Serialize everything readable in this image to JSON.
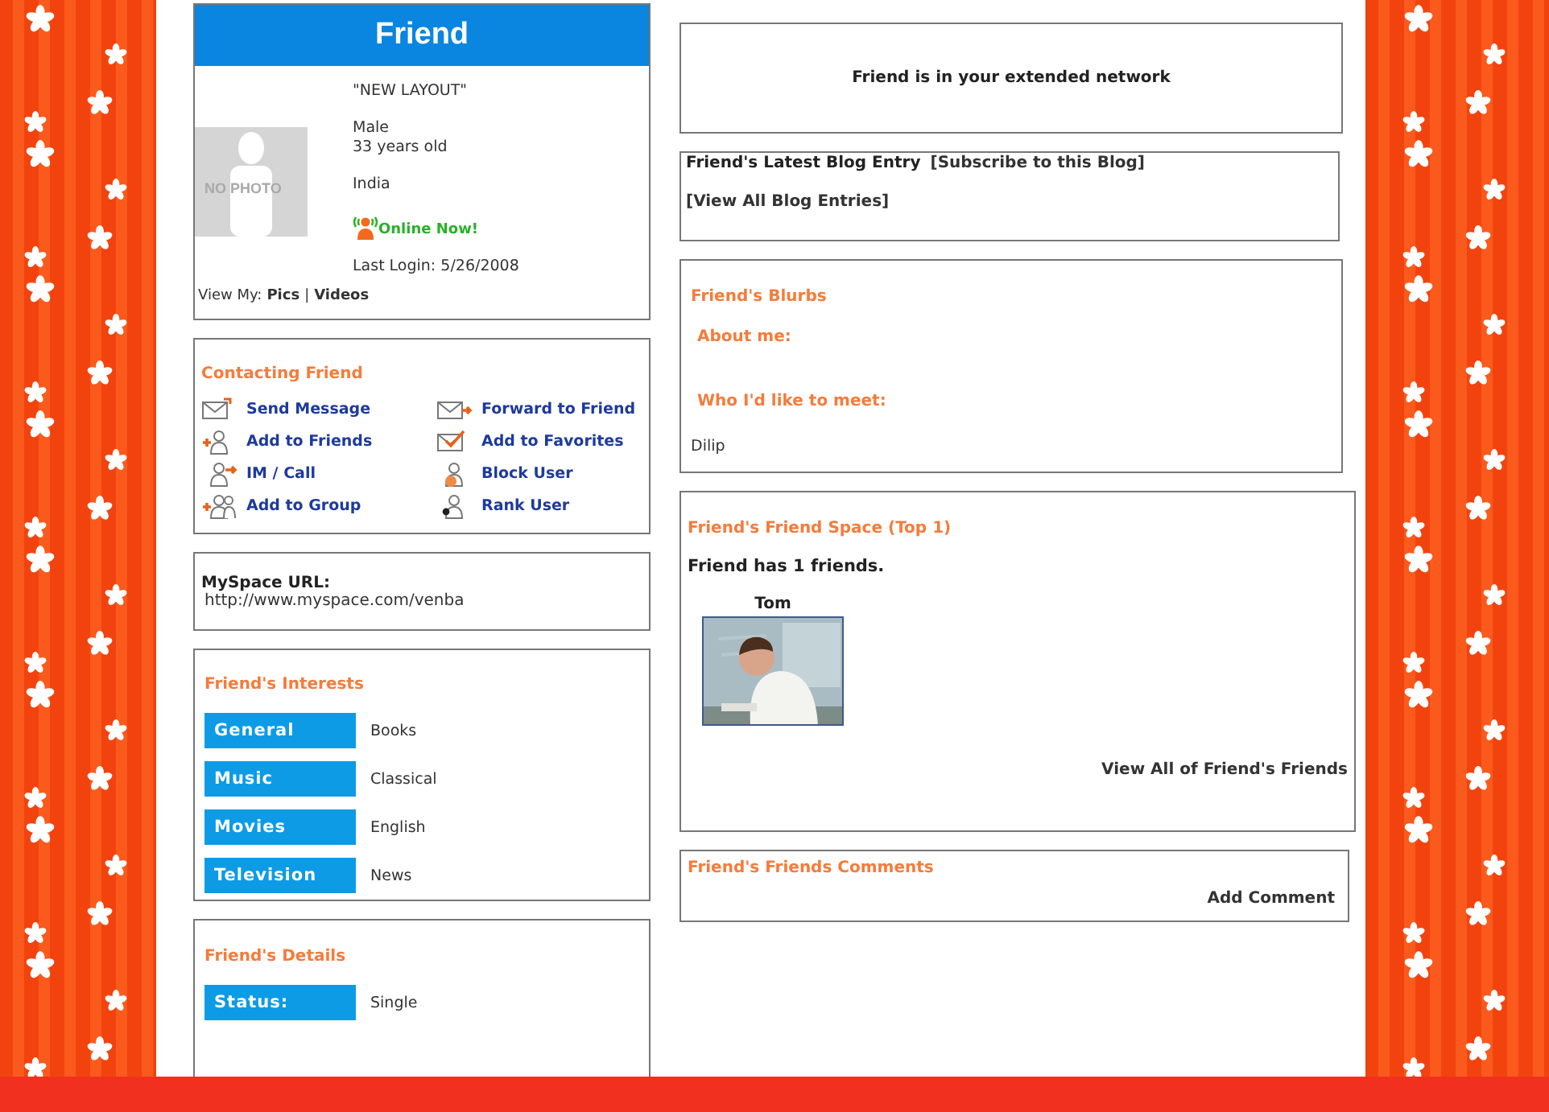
{
  "profile": {
    "title": "Friend",
    "photo_label": "NO PHOTO",
    "headline": "\"NEW LAYOUT\"",
    "gender": "Male",
    "age": "33 years old",
    "location": "India",
    "online_status": "Online Now!",
    "last_login": "Last Login: 5/26/2008",
    "view_my_label": "View My:",
    "view_links": [
      "Pics",
      "Videos"
    ],
    "view_separator": "|"
  },
  "contacting": {
    "heading": "Contacting Friend",
    "actions": [
      {
        "kind": "message",
        "label": "Send Message"
      },
      {
        "kind": "forward",
        "label": "Forward to Friend"
      },
      {
        "kind": "addfriend",
        "label": "Add to Friends"
      },
      {
        "kind": "favorite",
        "label": "Add to Favorites"
      },
      {
        "kind": "call",
        "label": "IM / Call"
      },
      {
        "kind": "block",
        "label": "Block User"
      },
      {
        "kind": "group",
        "label": "Add to Group"
      },
      {
        "kind": "rank",
        "label": "Rank User"
      }
    ]
  },
  "url_box": {
    "label": "MySpace URL:",
    "url": "http://www.myspace.com/venba"
  },
  "interests": {
    "heading": "Friend's Interests",
    "rows": [
      {
        "label": "General",
        "value": "Books"
      },
      {
        "label": "Music",
        "value": "Classical"
      },
      {
        "label": "Movies",
        "value": "English"
      },
      {
        "label": "Television",
        "value": "News"
      }
    ]
  },
  "details": {
    "heading": "Friend's Details",
    "rows": [
      {
        "label": "Status:",
        "value": "Single"
      }
    ]
  },
  "network_notice": "Friend is in your extended network",
  "blog": {
    "heading": "Friend's Latest Blog Entry",
    "subscribe_link": "[Subscribe to this Blog]",
    "view_all_link": "[View All Blog Entries]"
  },
  "blurbs": {
    "heading": "Friend's Blurbs",
    "about_label": "About me:",
    "meet_label": "Who I'd like to meet:",
    "meet_text": "Dilip"
  },
  "friend_space": {
    "heading": "Friend's Friend Space (Top 1)",
    "count_text": "Friend has 1 friends.",
    "friends": [
      {
        "name": "Tom"
      }
    ],
    "view_all_link": "View All of Friend's Friends"
  },
  "comments": {
    "heading": "Friend's Friends Comments",
    "add_link": "Add Comment"
  }
}
